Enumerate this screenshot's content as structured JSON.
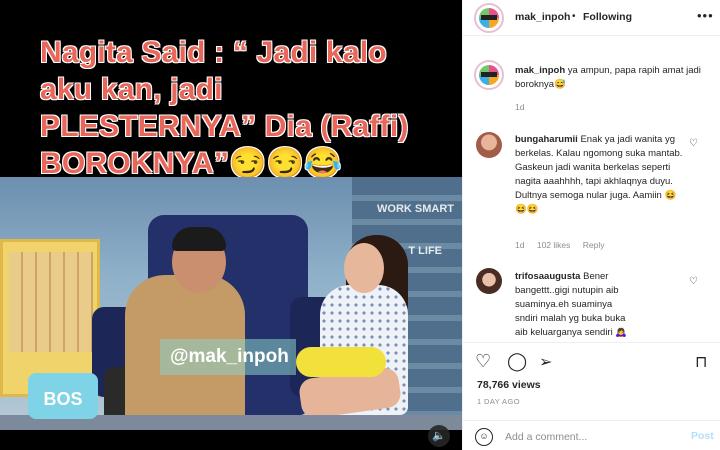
{
  "media": {
    "caption": "Nagita Said : “ Jadi kalo aku kan, jadi PLESTERNYA” Dia (Raffi) BOROKNYA”😏😏😂",
    "watermark": "@mak_inpoh",
    "wall_text_1": "WORK SMART",
    "wall_text_2": "T LIFE",
    "set_logo": "BOS",
    "mute_icon": "speaker-icon"
  },
  "header": {
    "username": "mak_inpoh",
    "separator": "•",
    "following": "Following",
    "more": "•••"
  },
  "caption_comment": {
    "username": "mak_inpoh",
    "text": "ya ampun, papa rapih amat jadi boroknya😅",
    "time": "1d"
  },
  "comments": [
    {
      "username": "bungaharumii",
      "text": "Enak ya jadi wanita yg berkelas. Kalau ngomong suka mantab. Gaskeun jadi wanita berkelas seperti nagita aaahhhh, tapi akhlaqnya duyu. Dultnya semoga nular juga. Aamiin 😆😆😆",
      "time": "1d",
      "likes": "102 likes",
      "reply": "Reply"
    },
    {
      "username": "trifosaaugusta",
      "text": "Bener bangettt..gigi nutupin aib suaminya.eh suaminya sndiri malah yg buka buka aib keluarganya sendiri 🙇‍♀️"
    }
  ],
  "actions": {
    "like_icon": "heart-icon",
    "comment_icon": "comment-icon",
    "share_icon": "share-icon",
    "save_icon": "bookmark-icon",
    "views": "78,766 views",
    "date": "1 DAY AGO"
  },
  "comment_box": {
    "placeholder": "Add a comment...",
    "post_label": "Post"
  },
  "colors": {
    "caption_red": "#e8675a",
    "link_blue_disabled": "#b2dffc",
    "muted_gray": "#8e8e8e"
  }
}
